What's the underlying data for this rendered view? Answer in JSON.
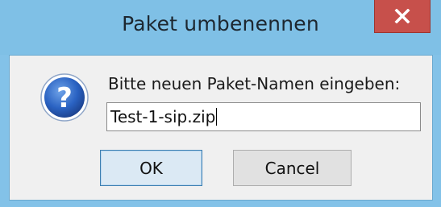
{
  "window": {
    "title": "Paket umbenennen",
    "close_label": "x"
  },
  "dialog": {
    "icon": "question-icon",
    "prompt": "Bitte neuen Paket-Namen eingeben:",
    "input_value": "Test-1-sip.zip",
    "ok_label": "OK",
    "cancel_label": "Cancel"
  },
  "colors": {
    "titlebar": "#7fc0e6",
    "close_button": "#c7504b",
    "client_background": "#f0f0f0",
    "icon_blue": "#2b5fb0"
  }
}
